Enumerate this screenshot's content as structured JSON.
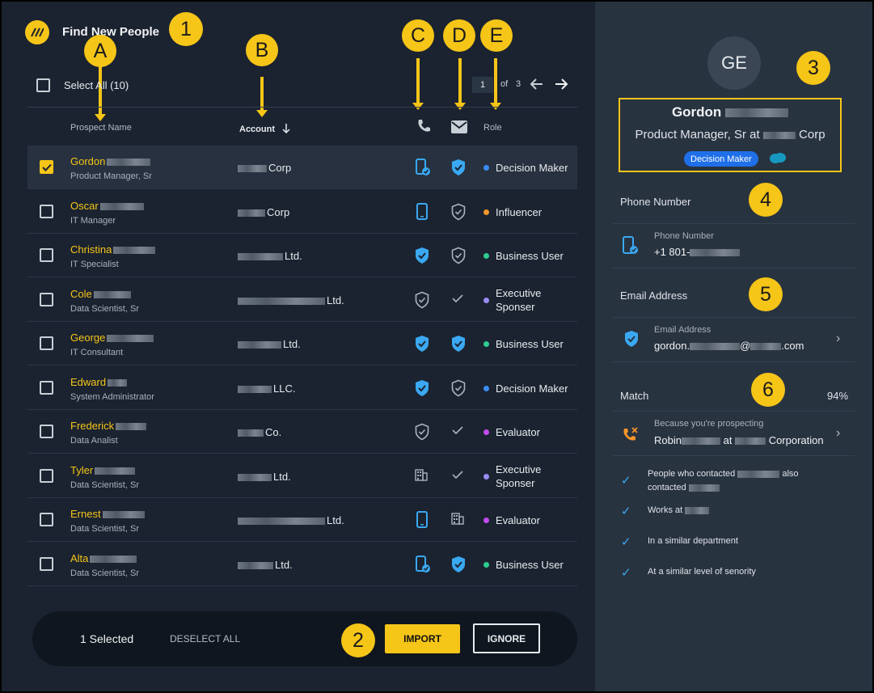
{
  "app": {
    "title": "Find New People"
  },
  "markers": {
    "m1": "1",
    "m2": "2",
    "m3": "3",
    "m4": "4",
    "m5": "5",
    "m6": "6",
    "a": "A",
    "b": "B",
    "c": "C",
    "d": "D",
    "e": "E"
  },
  "toolbar": {
    "select_all_label": "Select All (10)",
    "page_current": "1",
    "page_of": "of",
    "page_total": "3"
  },
  "columns": {
    "prospect": "Prospect Name",
    "account": "Account",
    "role": "Role"
  },
  "rows": [
    {
      "name": "Gordon",
      "title": "Product Manager, Sr",
      "account": "Corp",
      "role": "Decision Maker",
      "role_color": "#3a8df5",
      "selected": true
    },
    {
      "name": "Oscar",
      "title": "IT Manager",
      "account": "Corp",
      "role": "Influencer",
      "role_color": "#f5952a",
      "selected": false
    },
    {
      "name": "Christina",
      "title": "IT Specialist",
      "account": "Ltd.",
      "role": "Business User",
      "role_color": "#2ecc8f",
      "selected": false
    },
    {
      "name": "Cole",
      "title": "Data Scientist, Sr",
      "account": "Ltd.",
      "role_line1": "Executive",
      "role_line2": "Sponser",
      "role_color": "#9b8cf5",
      "selected": false
    },
    {
      "name": "George",
      "title": "IT Consultant",
      "account": "Ltd.",
      "role": "Business User",
      "role_color": "#2ecc8f",
      "selected": false
    },
    {
      "name": "Edward",
      "title": "System Administrator",
      "account": "LLC.",
      "role": "Decision Maker",
      "role_color": "#3a8df5",
      "selected": false
    },
    {
      "name": "Frederick",
      "title": "Data Analist",
      "account": "Co.",
      "role": "Evaluator",
      "role_color": "#c04cf0",
      "selected": false
    },
    {
      "name": "Tyler",
      "title": "Data Scientist, Sr",
      "account": "Ltd.",
      "role_line1": "Executive",
      "role_line2": "Sponser",
      "role_color": "#9b8cf5",
      "selected": false
    },
    {
      "name": "Ernest",
      "title": "Data Scientist, Sr",
      "account": "Ltd.",
      "role": "Evaluator",
      "role_color": "#c04cf0",
      "selected": false
    },
    {
      "name": "Alta",
      "title": "Data Scientist, Sr",
      "account": "Ltd.",
      "role": "Business User",
      "role_color": "#2ecc8f",
      "selected": false
    }
  ],
  "bottom": {
    "selected": "1 Selected",
    "deselect": "DESELECT ALL",
    "import": "IMPORT",
    "ignore": "IGNORE"
  },
  "panel": {
    "initials": "GE",
    "name": "Gordon",
    "position_prefix": "Product Manager, Sr at",
    "position_suffix": "Corp",
    "badge": "Decision Maker",
    "phone_header": "Phone Number",
    "phone_label": "Phone Number",
    "phone_value": "+1 801-",
    "email_header": "Email Address",
    "email_label": "Email Address",
    "email_prefix": "gordon.",
    "email_at": "@",
    "email_suffix": ".com",
    "match_label": "Match",
    "match_value": "94%",
    "because": "Because you're prospecting",
    "because_name": "Robin",
    "because_at": "at",
    "because_company": "Corporation",
    "reason1a": "People who contacted",
    "reason1b": "also",
    "reason1c": "contacted",
    "reason2": "Works at",
    "reason3": "In a similar department",
    "reason4": "At a similar level of senority"
  },
  "colors": {
    "accent": "#f5c518",
    "panel_bg": "#283340",
    "list_bg": "#1b2330",
    "blue": "#3aa8f2"
  }
}
